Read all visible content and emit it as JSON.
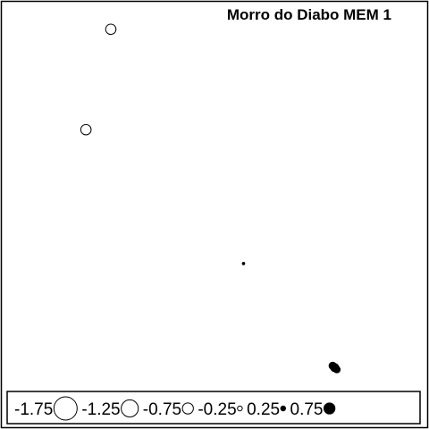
{
  "chart_data": {
    "type": "scatter",
    "title": "Morro do Diabo MEM 1",
    "xlabel": "",
    "ylabel": "",
    "grid": false,
    "legend_placement": "bottom",
    "encoding": "symbol size = magnitude; open circle = negative value, filled = positive value",
    "legend": [
      {
        "label": "-1.75",
        "value": -1.75
      },
      {
        "label": "-1.25",
        "value": -1.25
      },
      {
        "label": "-0.75",
        "value": -0.75
      },
      {
        "label": "-0.25",
        "value": -0.25
      },
      {
        "label": "0.25",
        "value": 0.25
      },
      {
        "label": "0.75",
        "value": 0.75
      }
    ],
    "points": [
      {
        "x": 0.25,
        "y": 0.95,
        "value": -0.7
      },
      {
        "x": 0.19,
        "y": 0.68,
        "value": -0.7
      },
      {
        "x": 0.57,
        "y": 0.32,
        "value": 0.05
      },
      {
        "x": 0.79,
        "y": 0.04,
        "value": 0.52
      },
      {
        "x": 0.785,
        "y": 0.045,
        "value": 0.45
      },
      {
        "x": 0.795,
        "y": 0.035,
        "value": 0.4
      }
    ],
    "colors": {
      "stroke": "#000000",
      "fill_positive": "#000000",
      "fill_negative": "#ffffff"
    }
  }
}
